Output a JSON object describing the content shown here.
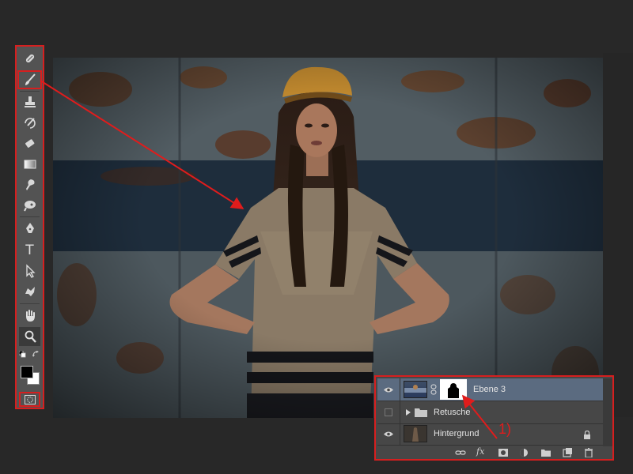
{
  "app": {
    "background_color": "#282828",
    "highlight_color": "#d61f1f"
  },
  "toolbar": {
    "tools": [
      {
        "name": "spot-healing-brush-icon"
      },
      {
        "name": "brush-icon",
        "highlighted": true
      },
      {
        "name": "clone-stamp-icon"
      },
      {
        "name": "history-brush-icon"
      },
      {
        "name": "eraser-icon"
      },
      {
        "name": "gradient-icon"
      },
      {
        "name": "smudge-icon"
      },
      {
        "name": "dodge-icon"
      },
      {
        "name": "pen-icon"
      },
      {
        "name": "type-icon",
        "glyph": "T"
      },
      {
        "name": "path-selection-icon"
      },
      {
        "name": "custom-shape-icon"
      },
      {
        "name": "hand-icon"
      },
      {
        "name": "zoom-icon",
        "active": true
      }
    ],
    "foreground_color": "#000000",
    "background_color": "#ffffff"
  },
  "layers_panel": {
    "layers": [
      {
        "name": "Ebene 3",
        "visible": true,
        "selected": true,
        "has_mask": true,
        "linked": true
      },
      {
        "name": "Retusche",
        "visible": false,
        "is_group": true
      },
      {
        "name": "Hintergrund",
        "visible": true,
        "locked": true
      }
    ],
    "footer_icons": [
      "link-icon",
      "fx-icon",
      "mask-icon",
      "adjustment-icon",
      "folder-icon",
      "new-layer-icon",
      "trash-icon"
    ],
    "fx_label": "fx"
  },
  "annotation": {
    "callout_label": "1)",
    "color": "#e01c1c"
  }
}
